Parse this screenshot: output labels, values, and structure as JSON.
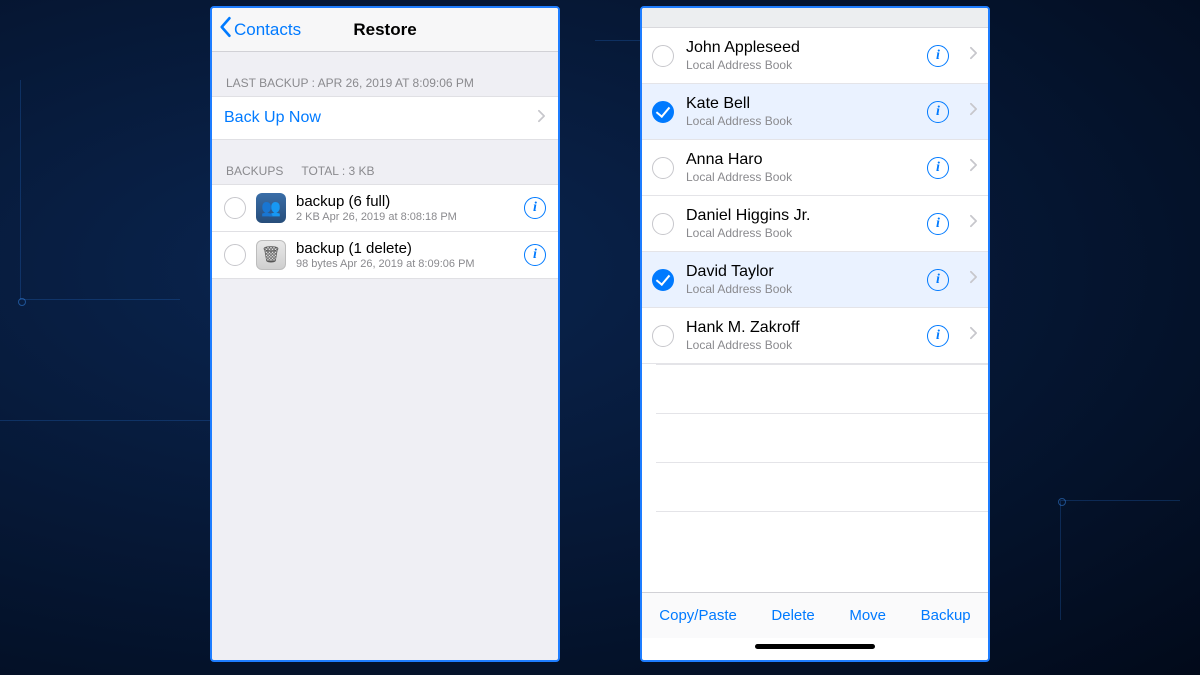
{
  "colors": {
    "accent": "#007aff"
  },
  "left": {
    "back_label": "Contacts",
    "title": "Restore",
    "last_backup_header": "LAST BACKUP : APR 26, 2019 AT 8:09:06 PM",
    "backup_now": "Back Up Now",
    "backups_header": "BACKUPS",
    "backups_total": "TOTAL : 3 KB",
    "rows": [
      {
        "icon": "contacts",
        "title": "backup (6 full)",
        "sub": "2 KB  Apr 26, 2019 at 8:08:18 PM"
      },
      {
        "icon": "trash",
        "title": "backup (1 delete)",
        "sub": "98 bytes  Apr 26, 2019 at 8:09:06 PM"
      }
    ]
  },
  "right": {
    "source_label": "Local Address Book",
    "contacts": [
      {
        "name": "John Appleseed",
        "selected": false
      },
      {
        "name": "Kate Bell",
        "selected": true
      },
      {
        "name": "Anna Haro",
        "selected": false
      },
      {
        "name": "Daniel Higgins Jr.",
        "selected": false
      },
      {
        "name": "David Taylor",
        "selected": true
      },
      {
        "name": "Hank M. Zakroff",
        "selected": false
      }
    ],
    "toolbar": {
      "copy": "Copy/Paste",
      "delete": "Delete",
      "move": "Move",
      "backup": "Backup"
    }
  }
}
